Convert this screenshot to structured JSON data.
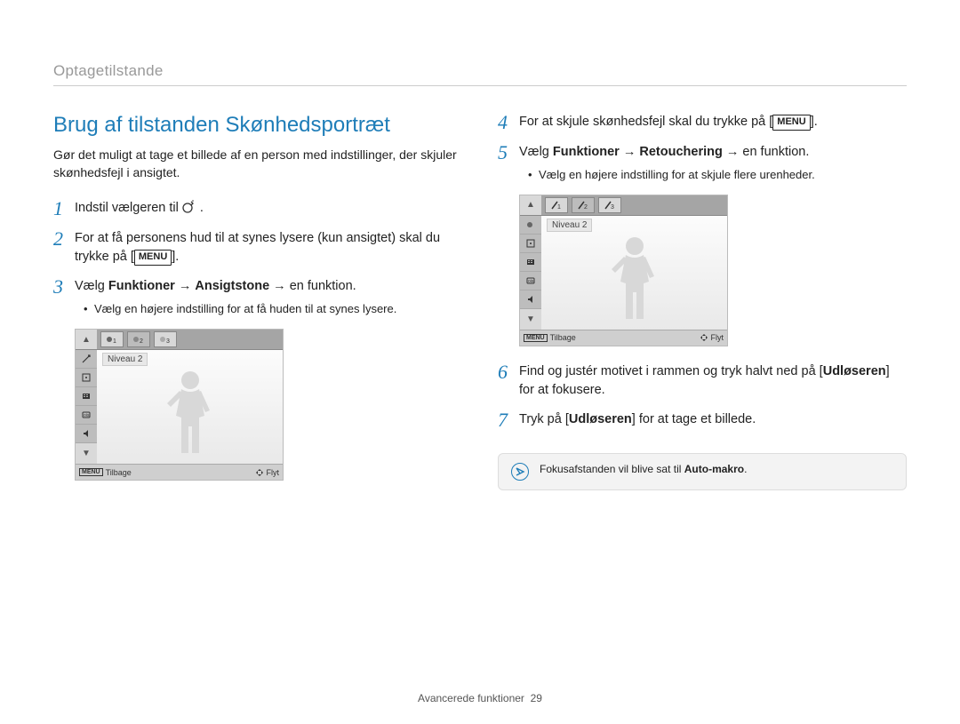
{
  "breadcrumb": "Optagetilstande",
  "section_title": "Brug af tilstanden Skønhedsportræt",
  "intro": "Gør det muligt at tage et billede af en person med indstillinger, der skjuler skønhedsfejl i ansigtet.",
  "steps_left": {
    "s1_pre": "Indstil vælgeren til ",
    "s1_post": ".",
    "s2_a": "For at få personens hud til at synes lysere (kun ansigtet) skal du trykke på [",
    "s2_menu": "MENU",
    "s2_b": "].",
    "s3_a": "Vælg ",
    "s3_b1": "Funktioner",
    "s3_arrow1": " → ",
    "s3_b2": "Ansigtstone",
    "s3_arrow2": " → ",
    "s3_c": "en funktion.",
    "s3_bullet": "Vælg en højere indstilling for at få huden til at synes lysere."
  },
  "steps_right": {
    "s4_a": "For at skjule skønhedsfejl skal du trykke på [",
    "s4_menu": "MENU",
    "s4_b": "].",
    "s5_a": "Vælg ",
    "s5_b1": "Funktioner",
    "s5_arrow1": " → ",
    "s5_b2": "Retouchering",
    "s5_arrow2": " → ",
    "s5_c": "en funktion.",
    "s5_bullet": "Vælg en højere indstilling for at skjule flere urenheder.",
    "s6_a": "Find og justér motivet i rammen og tryk halvt ned på [",
    "s6_b": "Udløseren",
    "s6_c": "] for at fokusere.",
    "s7_a": "Tryk på [",
    "s7_b": "Udløseren",
    "s7_c": "] for at tage et billede."
  },
  "screen1": {
    "level": "Niveau 2",
    "back": "Tilbage",
    "move": "Flyt"
  },
  "screen2": {
    "level": "Niveau 2",
    "back": "Tilbage",
    "move": "Flyt"
  },
  "note": {
    "text_a": "Fokusafstanden vil blive sat til ",
    "text_b": "Auto-makro",
    "text_c": "."
  },
  "footer": {
    "label": "Avancerede funktioner",
    "page": "29"
  },
  "nums": {
    "n1": "1",
    "n2": "2",
    "n3": "3",
    "n4": "4",
    "n5": "5",
    "n6": "6",
    "n7": "7"
  }
}
